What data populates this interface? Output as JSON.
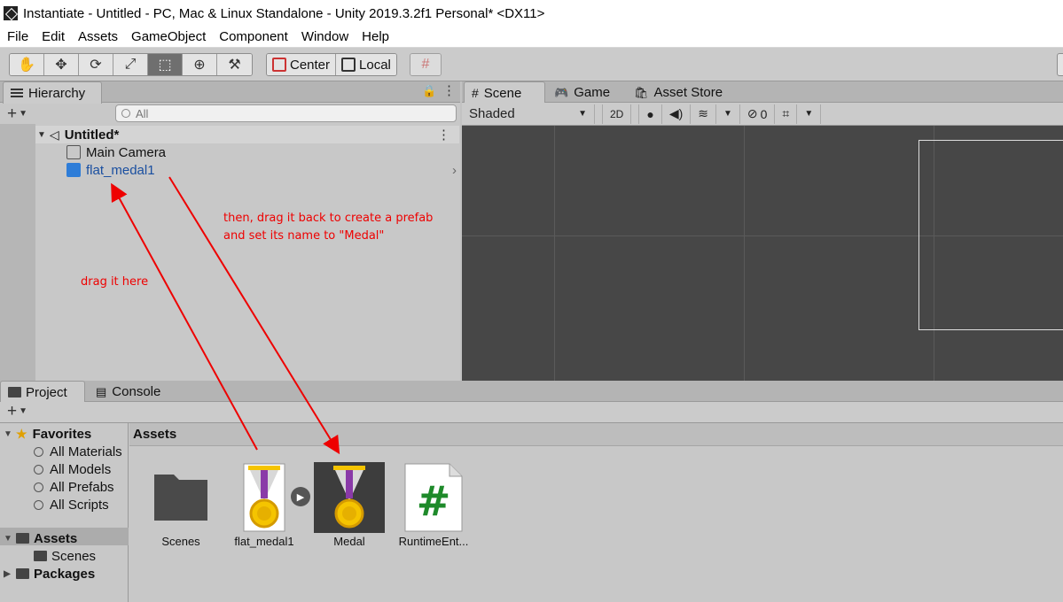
{
  "window": {
    "title": "Instantiate - Untitled - PC, Mac & Linux Standalone - Unity 2019.3.2f1 Personal* <DX11>"
  },
  "menu": {
    "items": [
      "File",
      "Edit",
      "Assets",
      "GameObject",
      "Component",
      "Window",
      "Help"
    ]
  },
  "toolbar": {
    "tools": [
      "hand-tool-icon",
      "move-tool-icon",
      "rotate-tool-icon",
      "scale-tool-icon",
      "rect-tool-icon",
      "transform-tool-icon",
      "custom-tool-icon"
    ],
    "active_tool": "rect-tool-icon",
    "pivot_label": "Center",
    "space_label": "Local"
  },
  "hierarchy": {
    "tab_label": "Hierarchy",
    "search_placeholder": "All",
    "scene_name": "Untitled*",
    "items": [
      "Main Camera",
      "flat_medal1"
    ]
  },
  "scene_view": {
    "tabs": [
      "Scene",
      "Game",
      "Asset Store"
    ],
    "shading": "Shaded",
    "mode_2d": "2D",
    "hidden_count": "0"
  },
  "project": {
    "tabs": [
      "Project",
      "Console"
    ],
    "favorites_label": "Favorites",
    "favorites": [
      "All Materials",
      "All Models",
      "All Prefabs",
      "All Scripts"
    ],
    "assets_label": "Assets",
    "assets_children": [
      "Scenes"
    ],
    "packages_label": "Packages",
    "breadcrumb": "Assets",
    "assets": [
      "Scenes",
      "flat_medal1",
      "Medal",
      "RuntimeEnt..."
    ]
  },
  "annotations": {
    "drag_here": "drag it here",
    "drag_back_line1": "then, drag it back to create a prefab",
    "drag_back_line2": "and set its name to \"Medal\""
  },
  "colors": {
    "annotation": "#e00000",
    "selected_text": "#1a4fa0",
    "medal_ribbon": "#8a3aa8",
    "medal_gold": "#f5c400",
    "script_hash": "#1e8a2a"
  }
}
